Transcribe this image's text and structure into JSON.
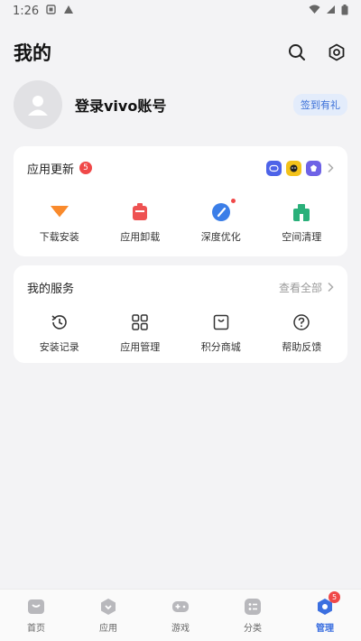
{
  "status_bar": {
    "time": "1:26"
  },
  "header": {
    "title": "我的"
  },
  "profile": {
    "login_label": "登录vivo账号",
    "checkin_label": "签到有礼"
  },
  "updates": {
    "title": "应用更新",
    "count": "5",
    "items": [
      {
        "label": "下载安装",
        "icon": "download-install-icon"
      },
      {
        "label": "应用卸载",
        "icon": "uninstall-icon"
      },
      {
        "label": "深度优化",
        "icon": "optimize-icon"
      },
      {
        "label": "空间清理",
        "icon": "clean-icon"
      }
    ]
  },
  "services": {
    "title": "我的服务",
    "view_all": "查看全部",
    "items": [
      {
        "label": "安装记录",
        "icon": "history-icon"
      },
      {
        "label": "应用管理",
        "icon": "app-grid-icon"
      },
      {
        "label": "积分商城",
        "icon": "points-mall-icon"
      },
      {
        "label": "帮助反馈",
        "icon": "help-icon"
      }
    ]
  },
  "nav": {
    "items": [
      {
        "label": "首页",
        "icon": "home-icon"
      },
      {
        "label": "应用",
        "icon": "apps-icon"
      },
      {
        "label": "游戏",
        "icon": "gamepad-icon"
      },
      {
        "label": "分类",
        "icon": "category-icon"
      },
      {
        "label": "管理",
        "icon": "manage-icon"
      }
    ],
    "manage_badge": "5"
  },
  "colors": {
    "accent": "#3b6fe0",
    "badge": "#f04848",
    "background": "#f3f3f5"
  }
}
